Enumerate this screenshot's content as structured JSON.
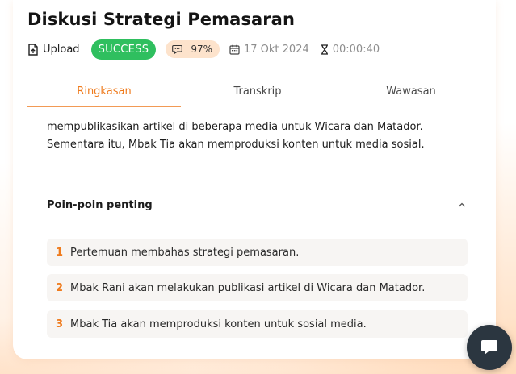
{
  "page": {
    "title": "Diskusi Strategi Pemasaran"
  },
  "meta": {
    "upload_label": "Upload",
    "status_badge": "SUCCESS",
    "score": "97%",
    "date": "17 Okt 2024",
    "duration": "00:00:40",
    "icons": [
      "upload-file-icon",
      "comment-icon",
      "calendar-icon",
      "hourglass-icon"
    ]
  },
  "tabs": [
    {
      "label": "Ringkasan",
      "active": true
    },
    {
      "label": "Transkrip",
      "active": false
    },
    {
      "label": "Wawasan",
      "active": false
    }
  ],
  "summary": {
    "text": "mempublikasikan artikel di beberapa media untuk Wicara dan Matador. Sementara itu, Mbak Tia akan memproduksi konten untuk media sosial."
  },
  "key_points": {
    "title": "Poin-poin penting",
    "items": [
      {
        "number": "1",
        "text": "Pertemuan membahas strategi pemasaran."
      },
      {
        "number": "2",
        "text": "Mbak Rani akan melakukan publikasi artikel di Wicara dan Matador."
      },
      {
        "number": "3",
        "text": "Mbak Tia akan memproduksi konten untuk sosial media."
      }
    ]
  },
  "colors": {
    "accent": "#ef7b1d",
    "success": "#2fbf5f",
    "score_bg": "#fde3cc",
    "fab": "#2b3640"
  }
}
